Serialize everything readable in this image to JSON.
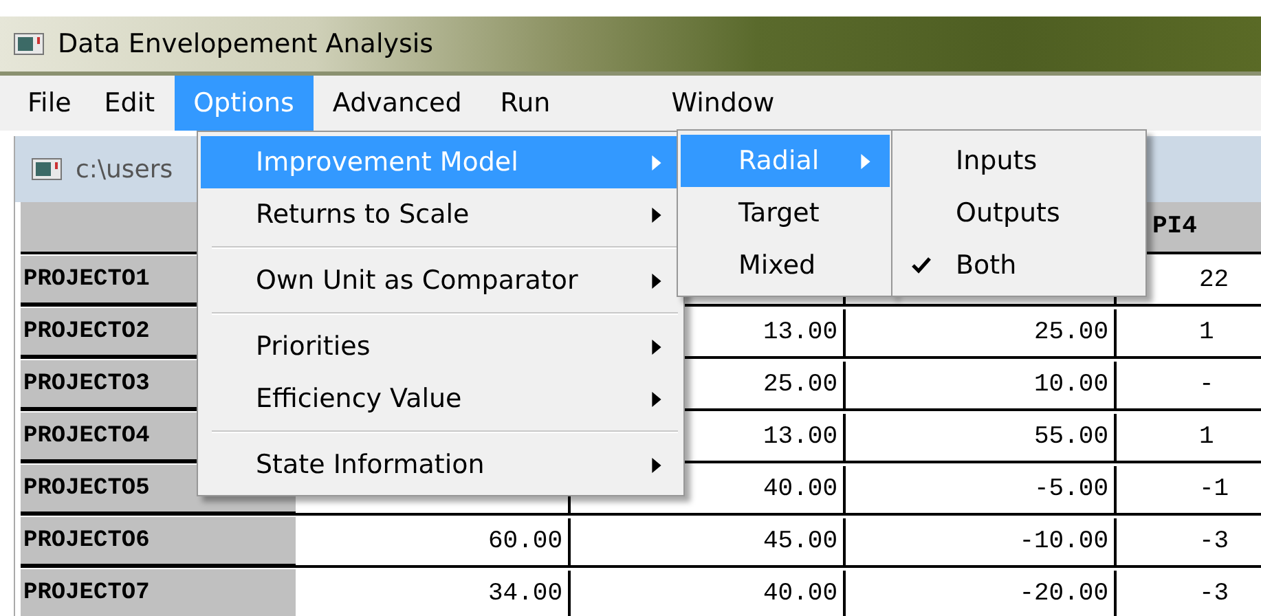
{
  "window": {
    "title": "Data Envelopement Analysis"
  },
  "menubar": [
    {
      "label": "File",
      "selected": false
    },
    {
      "label": "Edit",
      "selected": false
    },
    {
      "label": "Options",
      "selected": true
    },
    {
      "label": "Advanced",
      "selected": false
    },
    {
      "label": "Run",
      "selected": false
    },
    {
      "label": "Window",
      "selected": false
    }
  ],
  "child_window": {
    "title": "c:\\users"
  },
  "table": {
    "columns": [
      null,
      null,
      null,
      null,
      "PI4"
    ],
    "rows": [
      {
        "name": "PROJECTO1",
        "cells": [
          null,
          null,
          null,
          "22"
        ]
      },
      {
        "name": "PROJECTO2",
        "cells": [
          null,
          "13.00",
          "25.00",
          "1"
        ]
      },
      {
        "name": "PROJECTO3",
        "cells": [
          null,
          "25.00",
          "10.00",
          "-"
        ]
      },
      {
        "name": "PROJECTO4",
        "cells": [
          null,
          "13.00",
          "55.00",
          "1"
        ]
      },
      {
        "name": "PROJECTO5",
        "cells": [
          null,
          "40.00",
          "-5.00",
          "-1"
        ]
      },
      {
        "name": "PROJECTO6",
        "cells": [
          "60.00",
          "45.00",
          "-10.00",
          "-3"
        ]
      },
      {
        "name": "PROJECTO7",
        "cells": [
          "34.00",
          "40.00",
          "-20.00",
          "-3"
        ]
      }
    ]
  },
  "options_menu": {
    "groups": [
      [
        {
          "label": "Improvement Model",
          "has_submenu": true,
          "selected": true
        },
        {
          "label": "Returns to Scale",
          "has_submenu": true,
          "selected": false
        }
      ],
      [
        {
          "label": "Own Unit as Comparator",
          "has_submenu": true,
          "selected": false
        }
      ],
      [
        {
          "label": "Priorities",
          "has_submenu": true,
          "selected": false
        },
        {
          "label": "Efficiency Value",
          "has_submenu": true,
          "selected": false
        }
      ],
      [
        {
          "label": "State Information",
          "has_submenu": true,
          "selected": false
        }
      ]
    ]
  },
  "improvement_submenu": {
    "items": [
      {
        "label": "Radial",
        "has_submenu": true,
        "selected": true
      },
      {
        "label": "Target",
        "has_submenu": false,
        "selected": false
      },
      {
        "label": "Mixed",
        "has_submenu": false,
        "selected": false
      }
    ]
  },
  "radial_submenu": {
    "items": [
      {
        "label": "Inputs",
        "checked": false
      },
      {
        "label": "Outputs",
        "checked": false
      },
      {
        "label": "Both",
        "checked": true
      }
    ]
  }
}
